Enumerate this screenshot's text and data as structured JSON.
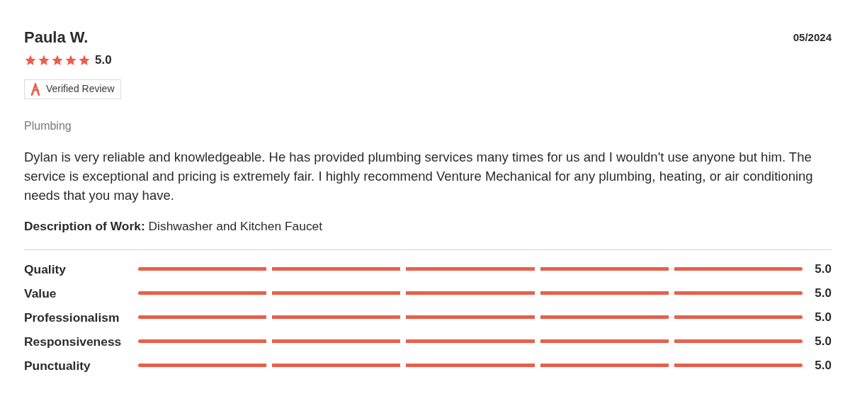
{
  "review": {
    "author": "Paula W.",
    "date": "05/2024",
    "stars": 5,
    "rating": "5.0",
    "badge": "Verified Review",
    "category": "Plumbing",
    "text": "Dylan is very reliable and knowledgeable. He has provided plumbing services many times for us and I wouldn't use anyone but him. The service is exceptional and pricing is extremely fair. I highly recommend Venture Mechanical for any plumbing, heating, or air conditioning needs that you may have.",
    "description_label": "Description of Work:",
    "description": "Dishwasher and Kitchen Faucet"
  },
  "ratings": [
    {
      "label": "Quality",
      "stars": 5,
      "value": "5.0"
    },
    {
      "label": "Value",
      "stars": 5,
      "value": "5.0"
    },
    {
      "label": "Professionalism",
      "stars": 5,
      "value": "5.0"
    },
    {
      "label": "Responsiveness",
      "stars": 5,
      "value": "5.0"
    },
    {
      "label": "Punctuality",
      "stars": 5,
      "value": "5.0"
    }
  ]
}
